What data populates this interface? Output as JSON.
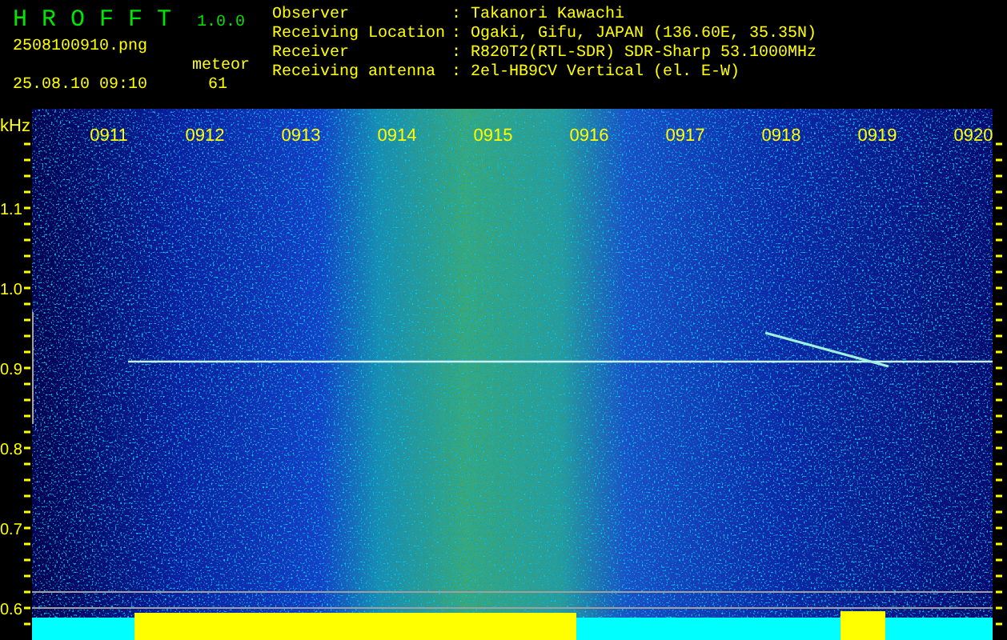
{
  "app": {
    "name": "H R O F F T",
    "version": "1.0.0"
  },
  "file": "2508100910.png",
  "datetime": "25.08.10 09:10",
  "meteor": {
    "label": "meteor",
    "count": "61"
  },
  "info": [
    {
      "label": "Observer",
      "separator": ":",
      "value": "Takanori Kawachi"
    },
    {
      "label": "Receiving Location",
      "separator": ":",
      "value": "Ogaki, Gifu, JAPAN (136.60E, 35.35N)"
    },
    {
      "label": "Receiver",
      "separator": ":",
      "value": "R820T2(RTL-SDR) SDR-Sharp 53.1000MHz"
    },
    {
      "label": "Receiving antenna",
      "separator": ":",
      "value": "2el-HB9CV Vertical (el. E-W)"
    }
  ],
  "plot": {
    "y_unit": "kHz",
    "y_labels": [
      "1.1",
      "1.0",
      "0.9",
      "0.8",
      "0.7",
      "0.6"
    ],
    "x_labels": [
      "0911",
      "0912",
      "0913",
      "0914",
      "0915",
      "0916",
      "0917",
      "0918",
      "0919",
      "0920"
    ]
  }
}
